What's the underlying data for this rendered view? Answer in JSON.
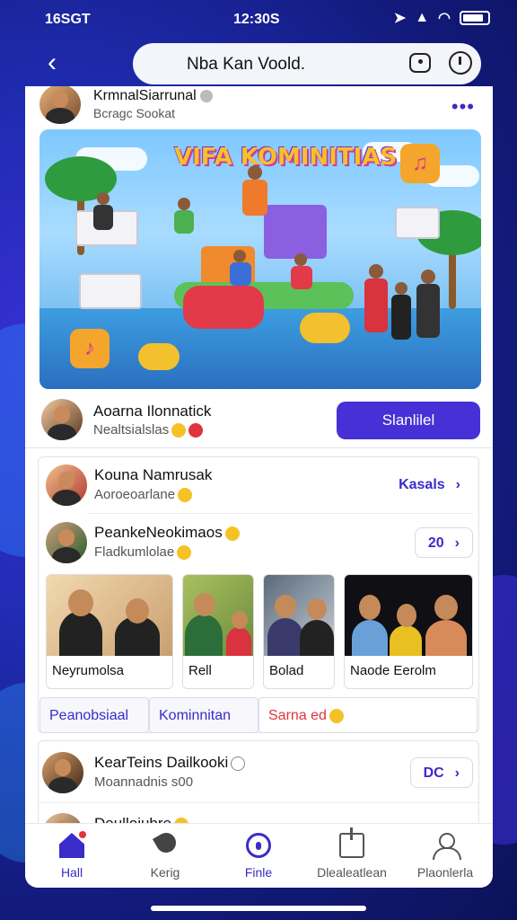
{
  "status": {
    "left": "16SGT",
    "center": "12:30S"
  },
  "topbar": {
    "title": "Nba Kan Voold."
  },
  "header": {
    "name": "KrmnalSiarrunal",
    "sub": "Bcragc Sookat"
  },
  "banner": {
    "title": "VIFA KOMINITIAS"
  },
  "row1": {
    "name": "Aoarna Ilonnatick",
    "sub": "Nealtsialslas",
    "button": "Slanlilel"
  },
  "list": [
    {
      "name": "Kouna Namrusak",
      "sub": "Aoroeoarlane",
      "action": "Kasals"
    },
    {
      "name": "PeankeNeokimaos",
      "sub": "Fladkumlolae",
      "action": "20"
    }
  ],
  "photos": [
    {
      "caption": "Neyrumolsa"
    },
    {
      "caption": "Rell"
    },
    {
      "caption": "Bolad"
    },
    {
      "caption": "Naode Eerolm"
    }
  ],
  "tabs": [
    {
      "label": "Peanobsiaal"
    },
    {
      "label": "Kominnitan"
    },
    {
      "label": "Sarna ed"
    }
  ],
  "list2": [
    {
      "name": "KearTeins Dailkooki",
      "sub": "Moannadnis s00",
      "action": "DC"
    },
    {
      "name": "Deulloiubre",
      "sub": ""
    }
  ],
  "nav": [
    {
      "label": "Hall"
    },
    {
      "label": "Kerig"
    },
    {
      "label": "Finle"
    },
    {
      "label": "Dlealeatlean"
    },
    {
      "label": "Plaonlerla"
    }
  ],
  "colors": {
    "accent": "#4630d6",
    "link": "#3b2bc8",
    "alert": "#e0343a"
  }
}
